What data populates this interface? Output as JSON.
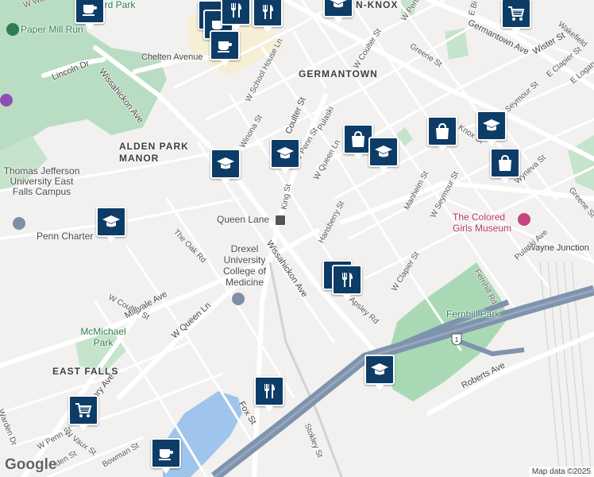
{
  "map": {
    "attribution": "Map data ©2025",
    "logo": "Google",
    "route_shield": "1",
    "neighborhoods": [
      "GERMANTOWN",
      "ALDEN PARK MANOR",
      "EAST FALLS",
      "N-KNOX"
    ],
    "arterials": [
      "Wissahickon Ave",
      "Wissahickon Ave",
      "Chelten Avenue",
      "Germantown Ave",
      "Midvale Ave",
      "Henry Ave",
      "W Queen Ln",
      "Roberts Ave",
      "Wayne Junction",
      "Lincoln Dr",
      "Coulter St",
      "Fox St"
    ],
    "streets": [
      "W Coulter St",
      "W Penn St",
      "Greene St",
      "Wister St",
      "W School House Ln",
      "Winona St",
      "W Penn St",
      "Pulaski",
      "W Queen Ln",
      "King St",
      "Hansberry St",
      "The Oak Rd",
      "Manheim St",
      "W Seymour St",
      "Wyneva St",
      "W Clapier St",
      "Fernhill Rd",
      "Pulaski Ave",
      "Apsley Rd",
      "Stokley St",
      "W Coulter St",
      "W Penn St",
      "W Vaux St",
      "Tilden St",
      "Bowman St",
      "Warden Dr",
      "Wakefield",
      "E Clapier St",
      "E Logan",
      "Knox St",
      "Seymour St",
      "Greene St",
      "E Bi",
      "W Walnut Ln",
      "Co"
    ],
    "places": [
      "Paper Mill Run",
      "Thomas Jefferson University East Falls Campus",
      "Penn Charter",
      "Queen Lane",
      "Drexel University College of Medicine",
      "McMichael Park",
      "Fernhill Park",
      "The Colored Girls Museum",
      "ord Park"
    ],
    "markers": [
      {
        "type": "cafe-icon"
      },
      {
        "type": "cafe-icon"
      },
      {
        "type": "cafe-icon"
      },
      {
        "type": "cafe-icon"
      },
      {
        "type": "restaurant-icon"
      },
      {
        "type": "restaurant-icon"
      },
      {
        "type": "restaurant-icon"
      },
      {
        "type": "restaurant-icon"
      },
      {
        "type": "restaurant-icon"
      },
      {
        "type": "school-icon"
      },
      {
        "type": "school-icon"
      },
      {
        "type": "school-icon"
      },
      {
        "type": "school-icon"
      },
      {
        "type": "school-icon"
      },
      {
        "type": "school-icon"
      },
      {
        "type": "school-icon"
      },
      {
        "type": "shopping-bag-icon"
      },
      {
        "type": "shopping-bag-icon"
      },
      {
        "type": "shopping-bag-icon"
      },
      {
        "type": "grocery-cart-icon"
      },
      {
        "type": "grocery-cart-icon"
      }
    ]
  }
}
